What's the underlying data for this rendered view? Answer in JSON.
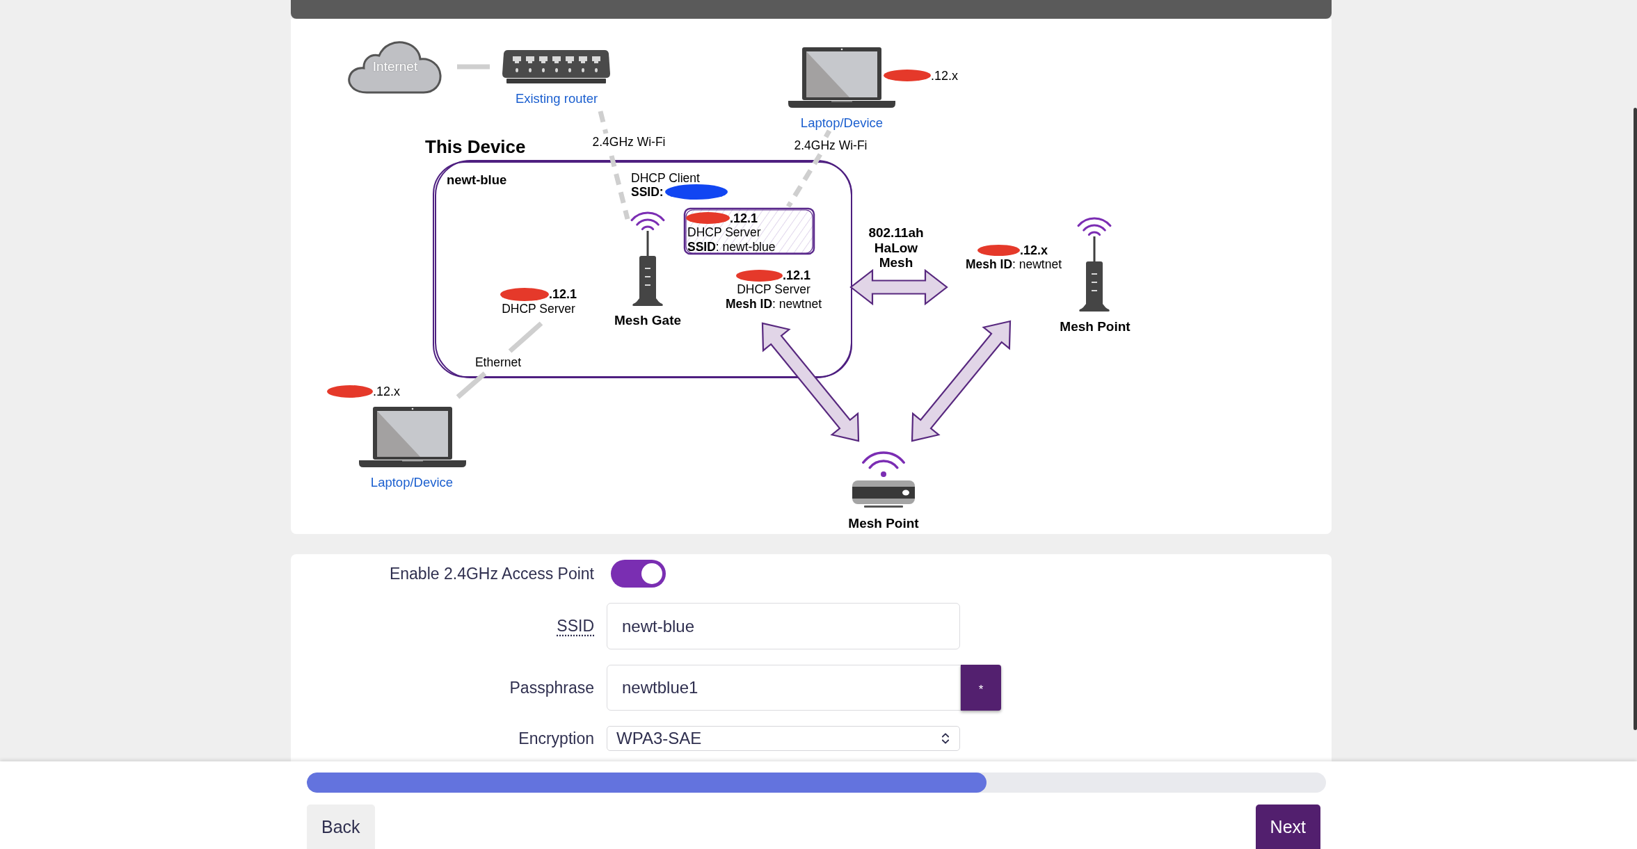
{
  "diagram": {
    "internet": {
      "label": "Internet"
    },
    "existing_router": {
      "label": "Existing router"
    },
    "laptop_top": {
      "address": ".12.x",
      "label": "Laptop/Device"
    },
    "wifi_links": [
      {
        "label": "2.4GHz Wi-Fi"
      },
      {
        "label": "2.4GHz Wi-Fi"
      }
    ],
    "this_device": {
      "title": "This Device",
      "network": "newt-blue",
      "client": {
        "role": "DHCP Client",
        "ssid_label": "SSID:"
      },
      "access_point": {
        "address": ".12.1",
        "role": "DHCP Server",
        "detail": "**SSID**: newt-blue"
      },
      "lan": {
        "address": ".12.1",
        "role": "DHCP Server"
      },
      "gate": {
        "label": "Mesh Gate"
      },
      "mesh": {
        "address": ".12.1",
        "role": "DHCP Server",
        "detail": "**Mesh ID**: newtnet"
      }
    },
    "halow_link": {
      "lines": [
        "802.11ah",
        "HaLow",
        "Mesh"
      ]
    },
    "mesh_point_right": {
      "address": ".12.x",
      "detail": "**Mesh ID**: newtnet",
      "label": "Mesh Point"
    },
    "ethernet_link": {
      "label": "Ethernet"
    },
    "laptop_bottom": {
      "address": ".12.x",
      "label": "Laptop/Device"
    },
    "mesh_point_bottom": {
      "label": "Mesh Point"
    }
  },
  "form": {
    "fields": [
      {
        "kind": "toggle",
        "label": "Enable 2.4GHz Access Point",
        "abbr": false,
        "on": true
      },
      {
        "kind": "text",
        "label": "SSID",
        "abbr": true,
        "value": "newt-blue"
      },
      {
        "kind": "password",
        "label": "Passphrase",
        "abbr": false,
        "value": "newtblue1",
        "button": "*"
      },
      {
        "kind": "select",
        "label": "Encryption",
        "abbr": false,
        "value": "WPA3-SAE"
      }
    ]
  },
  "progress": {
    "level": 0.667
  },
  "buttons": [
    {
      "label": "Back",
      "kind": "secondary"
    },
    {
      "label": "Next",
      "kind": "primary"
    }
  ]
}
